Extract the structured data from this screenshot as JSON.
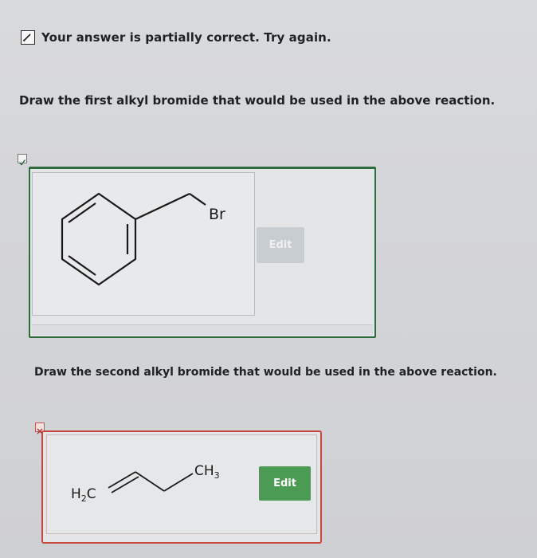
{
  "feedback": {
    "text": "Your answer is partially correct.  Try again."
  },
  "question1": {
    "prompt": "Draw the first alkyl bromide that would be used in the above reaction."
  },
  "answer1": {
    "atom_label": "Br",
    "edit_label": "Edit"
  },
  "question2": {
    "prompt": "Draw the second alkyl bromide that would be used in the above reaction."
  },
  "answer2": {
    "label_left": "H",
    "label_left_sub": "2",
    "label_left_tail": "C",
    "label_right": "CH",
    "label_right_sub": "3",
    "edit_label": "Edit"
  },
  "colors": {
    "correct_border": "#2f6b3d",
    "incorrect_border": "#c6473d",
    "edit_button_active": "#4c9b54",
    "edit_button_disabled": "#c8cdd2"
  }
}
